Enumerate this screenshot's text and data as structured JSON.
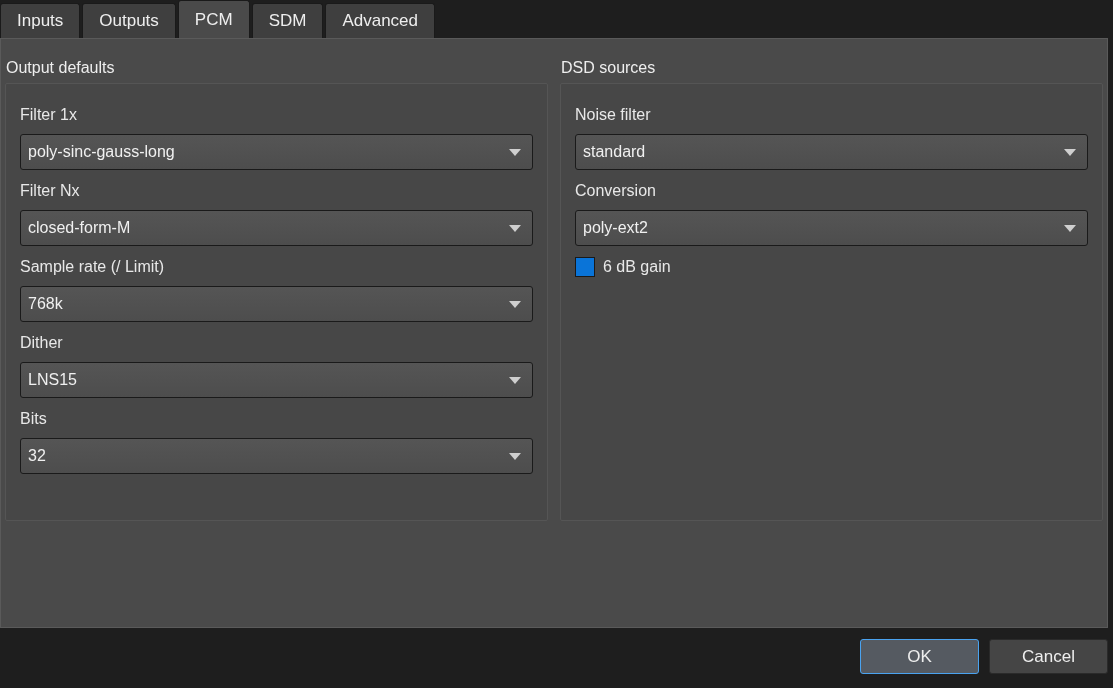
{
  "tabs": [
    {
      "label": "Inputs",
      "selected": false
    },
    {
      "label": "Outputs",
      "selected": false
    },
    {
      "label": "PCM",
      "selected": true
    },
    {
      "label": "SDM",
      "selected": false
    },
    {
      "label": "Advanced",
      "selected": false
    }
  ],
  "groups": [
    {
      "title": "Output defaults",
      "items": [
        {
          "kind": "dropdown",
          "label": "Filter 1x",
          "value": "poly-sinc-gauss-long"
        },
        {
          "kind": "dropdown",
          "label": "Filter Nx",
          "value": "closed-form-M"
        },
        {
          "kind": "dropdown",
          "label": "Sample rate (/ Limit)",
          "value": "768k"
        },
        {
          "kind": "dropdown",
          "label": "Dither",
          "value": "LNS15"
        },
        {
          "kind": "dropdown",
          "label": "Bits",
          "value": "32"
        }
      ]
    },
    {
      "title": "DSD sources",
      "items": [
        {
          "kind": "dropdown",
          "label": "Noise filter",
          "value": "standard"
        },
        {
          "kind": "dropdown",
          "label": "Conversion",
          "value": "poly-ext2"
        },
        {
          "kind": "checkbox",
          "label": "6 dB gain",
          "checked": true
        }
      ]
    }
  ],
  "buttons": [
    {
      "label": "OK",
      "default": true
    },
    {
      "label": "Cancel",
      "default": false
    }
  ]
}
